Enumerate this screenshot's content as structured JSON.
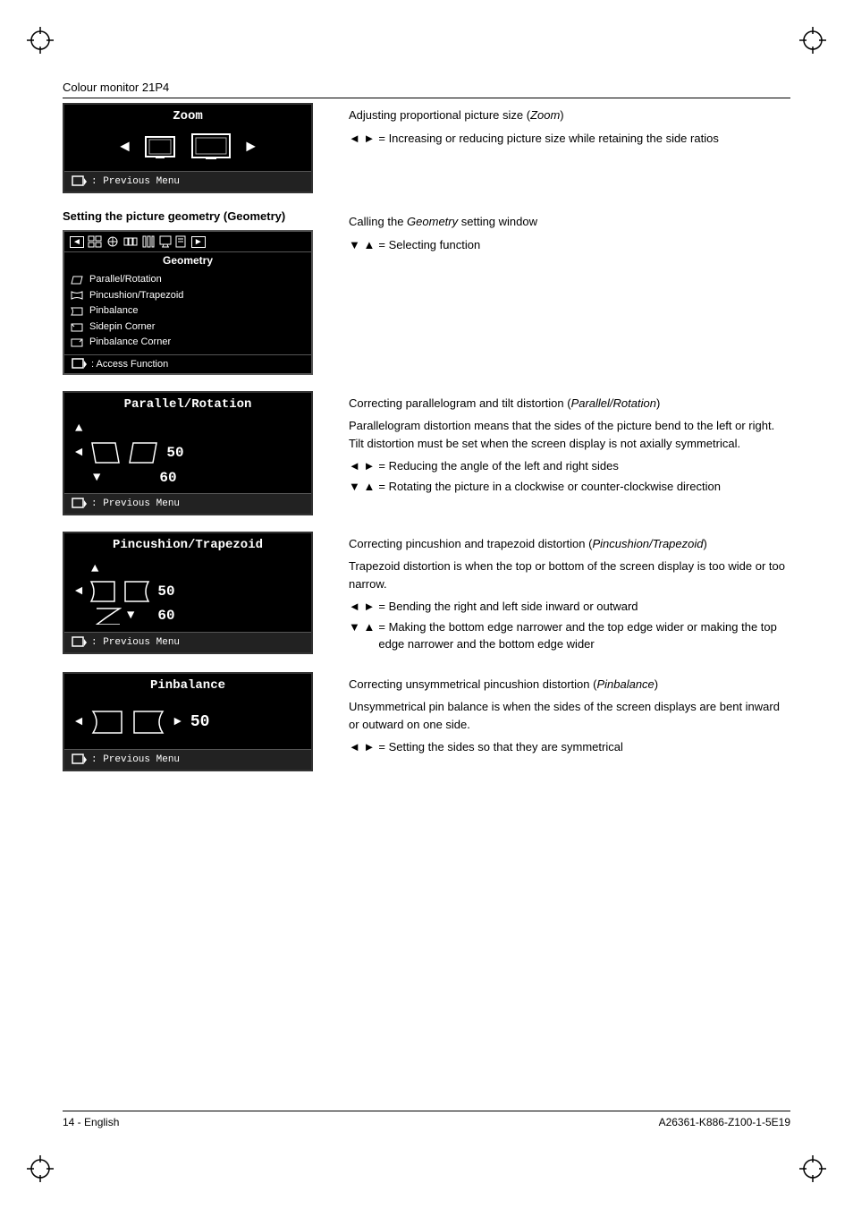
{
  "page": {
    "title": "Colour monitor 21P4",
    "footer_left": "14 - English",
    "footer_right": "A26361-K886-Z100-1-5E19"
  },
  "zoom_section": {
    "heading": "",
    "osd_title": "Zoom",
    "osd_footer_label": ": Previous Menu",
    "desc_title": "Adjusting proportional picture size (Zoom)",
    "desc_title_plain": "Adjusting proportional picture size (",
    "desc_title_italic": "Zoom",
    "desc_title_end": ")",
    "bullet1_arrows": "◄ ►",
    "bullet1_text": "= Increasing or reducing picture size while retaining the side ratios"
  },
  "geometry_section": {
    "heading": "Setting the picture geometry (Geometry)",
    "osd_topbar_title": "Geometry",
    "menu_items": [
      {
        "icon": "⇄",
        "label": "Parallel/Rotation"
      },
      {
        "icon": "◻",
        "label": "Pincushion/Trapezoid"
      },
      {
        "icon": "◻",
        "label": "Pinbalance"
      },
      {
        "icon": "◻",
        "label": "Sidepin Corner"
      },
      {
        "icon": "◻",
        "label": "Pinbalance Corner"
      }
    ],
    "osd_footer_label": ": Access Function",
    "desc_line1": "Calling the ",
    "desc_italic": "Geometry",
    "desc_line1_end": " setting window",
    "bullet1_arrows": "▼ ▲",
    "bullet1_text": "= Selecting function"
  },
  "parallel_section": {
    "osd_title": "Parallel/Rotation",
    "number_top": "50",
    "number_bottom": "60",
    "osd_footer_label": ": Previous Menu",
    "desc_title_plain": "Correcting parallelogram and tilt distortion (",
    "desc_title_italic": "Parallel/Rotation",
    "desc_title_end": ")",
    "desc_body": "Parallelogram distortion means that the sides of the picture bend to the left or right. Tilt distortion must be set when the screen display is not axially symmetrical.",
    "bullet1_arrows": "◄ ►",
    "bullet1_text": "= Reducing the angle of the left and right sides",
    "bullet2_arrows": "▼ ▲",
    "bullet2_text": "= Rotating the picture in a clockwise or counter-clockwise direction"
  },
  "pincushion_section": {
    "osd_title": "Pincushion/Trapezoid",
    "number_top": "50",
    "number_bottom": "60",
    "osd_footer_label": ": Previous Menu",
    "desc_title_plain": "Correcting pincushion and trapezoid distortion (",
    "desc_title_italic": "Pincushion/Trapezoid",
    "desc_title_end": ")",
    "desc_body": "Trapezoid distortion is when the top or bottom of the screen display is too wide or too narrow.",
    "bullet1_arrows": "◄ ►",
    "bullet1_text": "= Bending the right and left side inward or outward",
    "bullet2_arrows": "▼ ▲",
    "bullet2_text": "= Making the bottom edge narrower and the top edge wider or making the top edge narrower and the bottom edge wider"
  },
  "pinbalance_section": {
    "osd_title": "Pinbalance",
    "number": "50",
    "osd_footer_label": ": Previous Menu",
    "desc_title_plain": "Correcting unsymmetrical pincushion distortion (",
    "desc_title_italic": "Pinbalance",
    "desc_title_end": ")",
    "desc_body": "Unsymmetrical pin balance is when the sides of the screen displays are bent inward or outward on one side.",
    "bullet1_arrows": "◄ ►",
    "bullet1_text": "= Setting the sides so that they are symmetrical"
  }
}
